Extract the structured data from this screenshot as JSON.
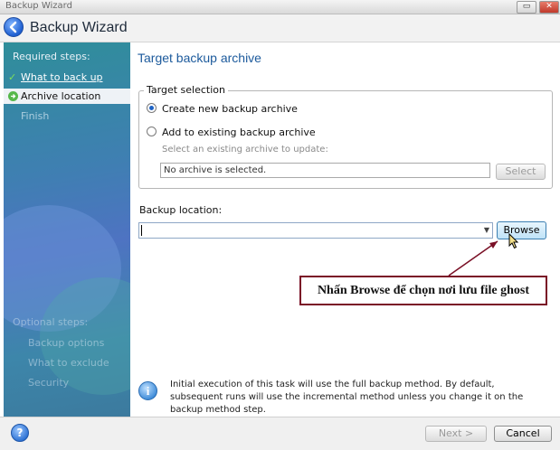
{
  "window": {
    "title": "Backup Wizard",
    "restore_glyph": "▭",
    "close_glyph": "✕"
  },
  "header": {
    "title": "Backup Wizard"
  },
  "sidebar": {
    "section_required": "Required steps:",
    "step_done": "What to back up",
    "step_active": "Archive location",
    "step_next": "Finish",
    "section_optional": "Optional steps:",
    "optional_items": [
      "Backup options",
      "What to exclude",
      "Security"
    ]
  },
  "main": {
    "page_title": "Target backup archive",
    "group_title": "Target selection",
    "radio_new": "Create new backup archive",
    "radio_existing": "Add to existing backup archive",
    "select_hint": "Select an existing archive to update:",
    "archive_value": "No archive is selected.",
    "select_button": "Select",
    "location_label": "Backup location:",
    "location_value": "",
    "browse_button": "Browse",
    "annotation": "Nhấn Browse để chọn nơi lưu file ghost",
    "info_text": "Initial execution of this task will use the full backup method. By default, subsequent runs will use the incremental method unless you change it on the backup method step."
  },
  "footer": {
    "next_button": "Next >",
    "cancel_button": "Cancel"
  },
  "colors": {
    "accent": "#1c5a9c",
    "annotation_border": "#7a1026"
  }
}
